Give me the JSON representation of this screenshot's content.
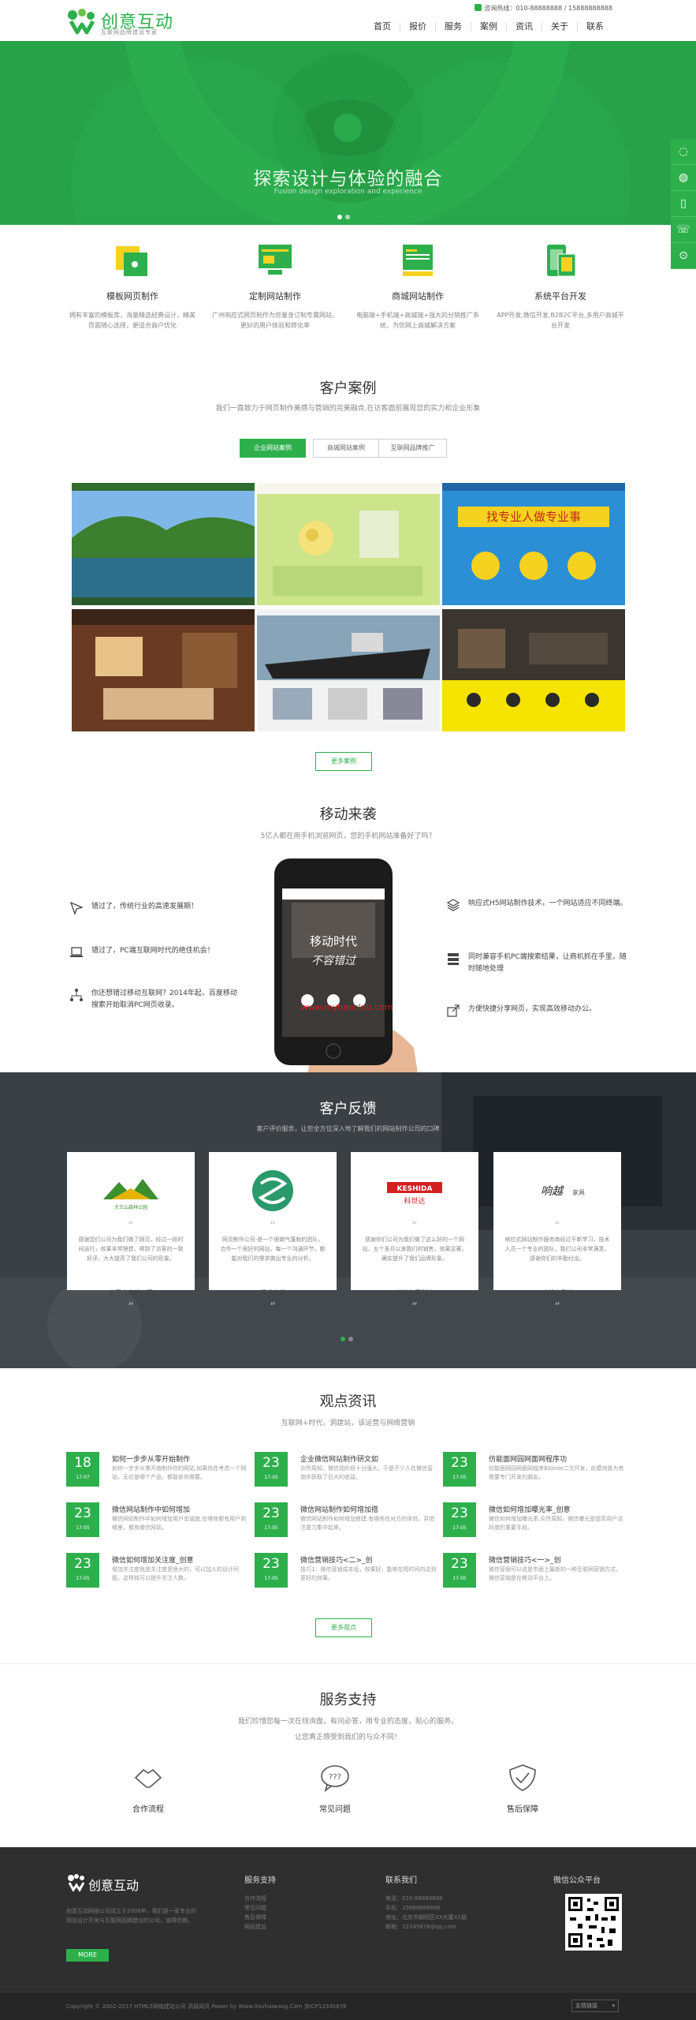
{
  "header": {
    "logo": "创意互动",
    "logo_sub": "互联网品牌建设专家",
    "hotline": "咨询热线：010-88888888 / 15888888888",
    "nav": [
      "首页",
      "报价",
      "服务",
      "案例",
      "资讯",
      "关于",
      "联系"
    ]
  },
  "banner": {
    "title": "探索设计与体验的融合",
    "subtitle": "Fusion design exploration and experience"
  },
  "sidebar": [
    "qq-icon",
    "qq-icon",
    "phone-icon",
    "telephone-icon",
    "top-icon"
  ],
  "services": [
    {
      "title": "模板网页制作",
      "desc": "拥有丰富的模板库，海量精选经典设计，精美页面随心选择，更适合商户优化"
    },
    {
      "title": "定制网站制作",
      "desc": "广州响应式网页制作为您量身订制专属网站，更好的用户体验和转化率"
    },
    {
      "title": "商城网站制作",
      "desc": "电脑端+手机端+商城端+强大的分销推广系统，为您网上商城解决方案"
    },
    {
      "title": "系统平台开发",
      "desc": "APP开发,微信开发,B2B2C平台,多用户商城平台开发"
    }
  ],
  "cases": {
    "title": "客户案例",
    "subtitle": "我们一直致力于网页制作美感与营销的完美融合,在访客面前展现您的实力和企业形象",
    "tabs": [
      "企业网站案例",
      "商城网站案例",
      "互联网品牌推广"
    ],
    "more": "更多案例",
    "banner_text_1": "找专业人做专业事"
  },
  "mobile": {
    "title": "移动来袭",
    "subtitle": "5亿人都在用手机浏览网页，您的手机网站准备好了吗？",
    "left": [
      "错过了，传统行业的高速发展期！",
      "错过了，PC端互联网时代的绝佳机会！",
      "你还想错过移动互联网？2014年起，百度移动搜索开始取消PC网页收录。"
    ],
    "right": [
      "响应式H5网站制作技术，一个网站适应不同终端。",
      "同时兼容手机PC端搜索结果，让商机抓在手里，随时随地处理",
      "方便快捷分享网页，实现高效移动办公。"
    ],
    "phone_text_1": "移动时代",
    "phone_text_2": "不容错过",
    "watermark": "www.myhaoclub.com"
  },
  "feedback": {
    "title": "客户反馈",
    "subtitle": "客户评价服务，让您全方位深入地了解我们的网站制作公司的口碑",
    "cards": [
      {
        "text": "感谢您们公司为我们做了网页，经过一段时间运行，效果非常理想，得到了访客的一致好评，大大提高了我们公司的形象。",
        "name": "大王山森林公园"
      },
      {
        "text": "网页制作公司-是一个很朝气蓬勃的团队，合作一个很好的网站，每一个沟通环节，都能对我们的需求做出专业的分析。",
        "name": "绿盛在线"
      },
      {
        "text": "感谢你们公司为我们做了这么好的一个网站，五个多月以来我们的销售，效果显著，确实提升了我们品牌形象。",
        "name": "鲜丝电子科技"
      },
      {
        "text": "响应式网站制作服务商经过不断学习，技术人员一个专业的团队，我们公司非常满意，感谢你们的辛勤付出。",
        "name": "响越家具馆"
      }
    ],
    "brand_1": "大王山森林公园",
    "brand_3": "KESHIDA",
    "brand_3_cn": "科世达",
    "brand_4": "响越",
    "brand_4_sub": "家具"
  },
  "news": {
    "title": "观点资讯",
    "subtitle": "互联网+时代，洞建站，该运营与网络营销",
    "items": [
      {
        "day": "18",
        "month": "17-07",
        "title": "如何一步步从零开始制作",
        "desc": "如何一步步从零开始制作你的网站,如果你在考虑一个网站，无论是哪个产品，都能依你需要。"
      },
      {
        "day": "23",
        "month": "17-05",
        "title": "企业微信网站制作研文如",
        "desc": "众所周知，微信现阶段十分强大，于是不少人在微信营销中获取了巨大的收益。"
      },
      {
        "day": "23",
        "month": "17-05",
        "title": "仿能面网园网面网程序功",
        "desc": "仿能面网园网面网程序如dede二次开发，此模块是为有需要专门开发的朋友。"
      },
      {
        "day": "23",
        "month": "17-05",
        "title": "微信网站制作中如何增加",
        "desc": "微信网站制作中如何增加用户忠诚度,在哪些都有用户到哪里，都有微信网站。"
      },
      {
        "day": "23",
        "month": "17-05",
        "title": "微信网站制作如何增加搭",
        "desc": "微信网站制作如何增加搭建,有哪些在对方的体验，并把注意力集中起来。"
      },
      {
        "day": "23",
        "month": "17-05",
        "title": "微信如何增加曝光率_创意",
        "desc": "微信如何增加曝光率,众所周知，微信曝光是提高用户活跃度的重要手段。"
      },
      {
        "day": "23",
        "month": "17-05",
        "title": "微信如何增加关注度_创意",
        "desc": "增加关注度就是关注度是很大的，可以加人的设计问题，这样就可以提升关注人数。"
      },
      {
        "day": "23",
        "month": "17-05",
        "title": "微信营销技巧<二>_创",
        "desc": "技巧1：微信营销成本低，效果好，能够在短时间内达到更好的效果。"
      },
      {
        "day": "23",
        "month": "17-05",
        "title": "微信营销技巧<一>_创",
        "desc": "微信营销可以说是市面上最新的一种互联网营销方式，微信营销是在移动平台上。"
      }
    ],
    "more": "更多观点"
  },
  "support": {
    "title": "服务支持",
    "line1": "我们珍惜您每一次在线询盘，有问必答，用专业的态度，贴心的服务。",
    "line2": "让您真正感受到我们的与众不同！",
    "items": [
      "合作流程",
      "常见问题",
      "售后保障"
    ]
  },
  "footer": {
    "logo": "创意互动",
    "about": "创意互动网络公司成立于2008年，我们是一家专业的网站设计开发与互联网品牌建设的公司，值得信赖。",
    "more": "MORE",
    "col1_title": "服务支持",
    "col1": [
      "合作流程",
      "常见问题",
      "售后保障",
      "网站建设"
    ],
    "col2_title": "联系我们",
    "col2": [
      "电话：010-88888888",
      "手机：15888888888",
      "地址：北京市朝阳区XX大厦XX层",
      "邮箱：12345678@qq.com"
    ],
    "col3_title": "微信公众平台",
    "copyright": "Copyright © 2002-2017 HTML5网络建站公司 高级网页 Power by Www.Xiuihaiwang.Com 京ICP12345678",
    "link_select": "友情链接"
  },
  "colors": {
    "brand": "#2db04c",
    "dark": "#2f2f2f"
  }
}
